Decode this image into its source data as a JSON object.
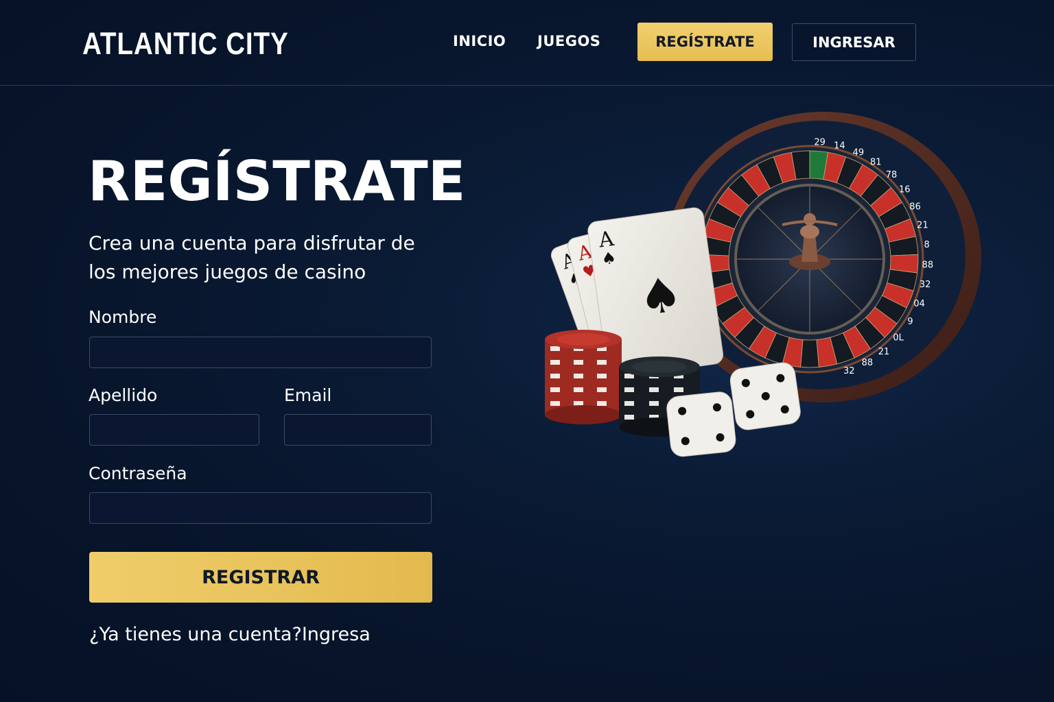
{
  "header": {
    "logo": "ATLANTIC CITY",
    "nav": {
      "inicio": "INICIO",
      "juegos": "JUEGOS",
      "register": "REGÍSTRATE",
      "login": "INGRESAR"
    }
  },
  "main": {
    "title": "REGÍSTRATE",
    "subtitle_line1": "Crea una cuenta para disfrutar de",
    "subtitle_line2": "los mejores juegos de casino",
    "form": {
      "nombre_label": "Nombre",
      "nombre_value": "",
      "apellido_label": "Apellido",
      "apellido_value": "",
      "email_label": "Email",
      "email_value": "",
      "password_label": "Contraseña",
      "password_value": "",
      "submit_label": "REGISTRAR"
    },
    "footer_question": "¿Ya tienes una cuenta?",
    "footer_link": "Ingresa"
  },
  "hero": {
    "roulette_numbers": [
      "29",
      "14",
      "49",
      "81",
      "78",
      "16",
      "86",
      "21",
      "8",
      "88",
      "32",
      "04",
      "9",
      "0L",
      "21",
      "88",
      "32"
    ],
    "card_rank": "A"
  },
  "colors": {
    "background": "#0a1a33",
    "accent_gold": "#e8c25a",
    "input_border": "#3a4a68",
    "roulette_red": "#c8312a"
  }
}
